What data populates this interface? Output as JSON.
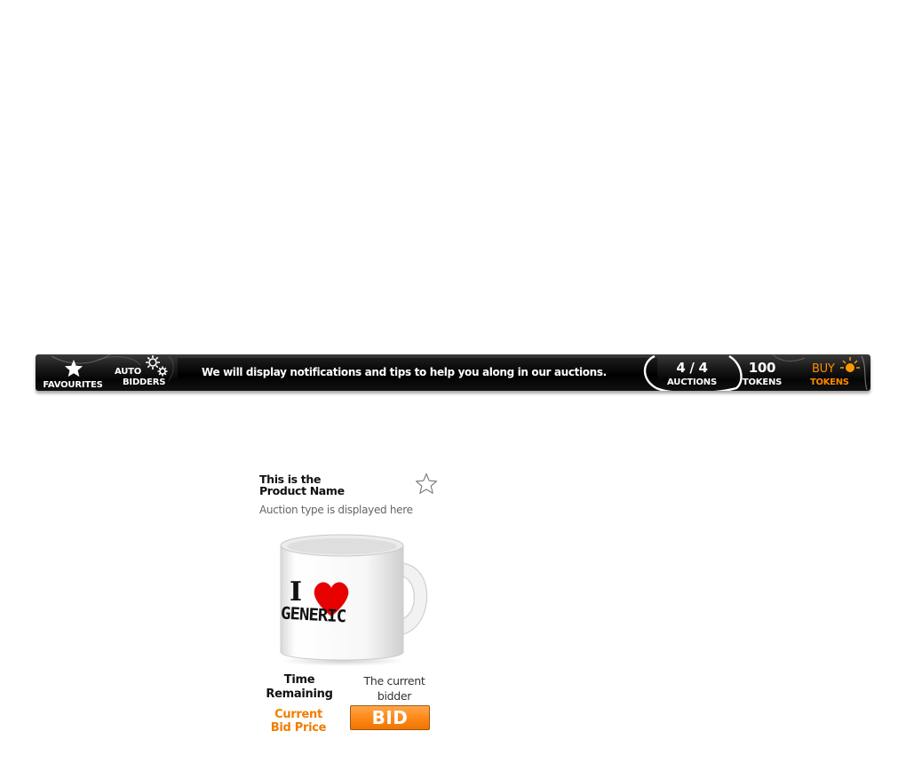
{
  "toolbar": {
    "favourites_label": "FAVOURITES",
    "auto_label": "AUTO",
    "bidders_label": "BIDDERS",
    "notification": "We will display notifications and tips to help you along in our auctions.",
    "auctions_count": "4 / 4",
    "auctions_label": "AUCTIONS",
    "tokens_count": "100",
    "tokens_label": "TOKENS",
    "buy_label": "BUY",
    "buy_tokens_label": "TOKENS",
    "icons": {
      "favourites": "star-icon",
      "auto_bidders": "gears-icon",
      "buy": "sun-icon"
    },
    "colors": {
      "accent": "#ff8a00",
      "bar": "#111111"
    }
  },
  "auction": {
    "title_line1": "This is the",
    "title_line2": "Product Name",
    "type_text": "Auction type is displayed here",
    "time_line1": "Time",
    "time_line2": "Remaining",
    "bidder_line1": "The current",
    "bidder_line2": "bidder",
    "price_line1": "Current",
    "price_line2": "Bid Price",
    "bid_label": "BID",
    "mug_text_line1": "I",
    "mug_text_line2": "GENERIC",
    "icons": {
      "favourite": "star-outline-icon",
      "product": "mug-image"
    },
    "colors": {
      "price": "#f07d00",
      "bid_button": "#ff8c1f"
    }
  }
}
